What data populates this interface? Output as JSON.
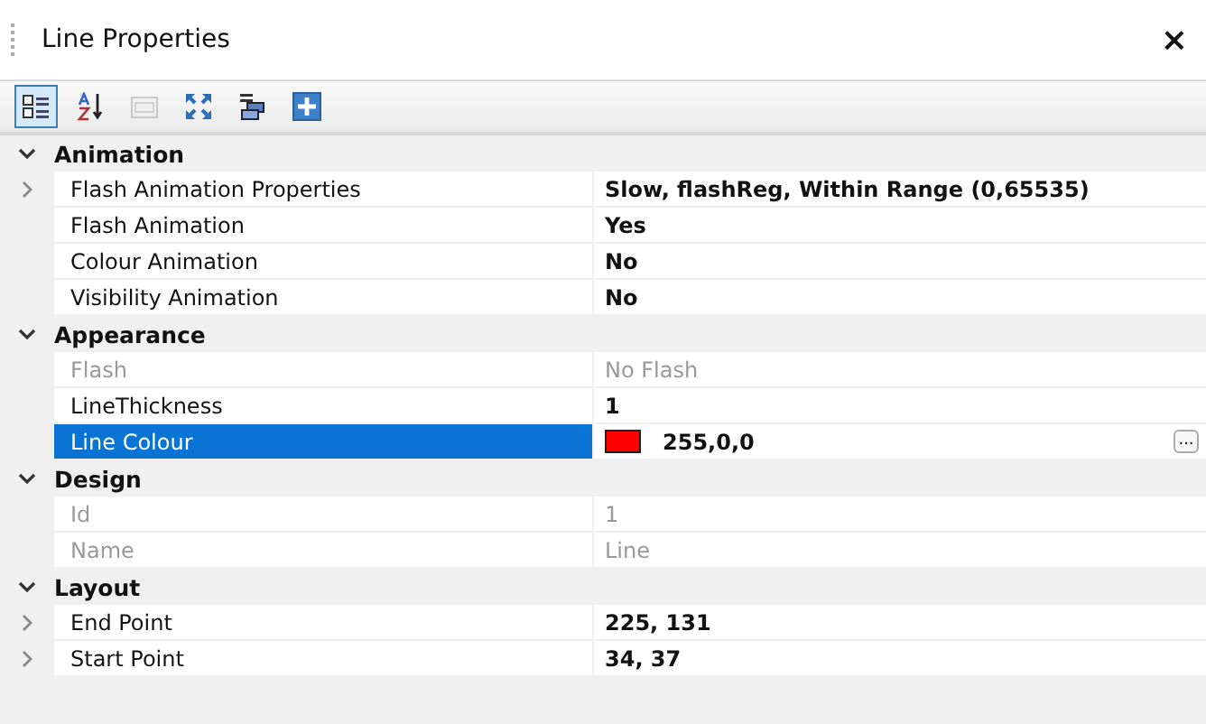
{
  "panel": {
    "title": "Line Properties",
    "close": "×"
  },
  "toolbar": [
    {
      "kind": "categorized",
      "selected": true,
      "disabled": false
    },
    {
      "kind": "alphabetical",
      "selected": false,
      "disabled": false
    },
    {
      "kind": "pages",
      "selected": false,
      "disabled": true
    },
    {
      "kind": "expand",
      "selected": false,
      "disabled": false
    },
    {
      "kind": "windows",
      "selected": false,
      "disabled": false
    },
    {
      "kind": "add",
      "selected": false,
      "disabled": false
    }
  ],
  "categories": [
    {
      "name": "Animation",
      "expanded": true,
      "properties": [
        {
          "name": "Flash Animation Properties",
          "value": "Slow, flashReg, Within Range (0,65535)",
          "expandable": true,
          "readonly": false,
          "selected": false
        },
        {
          "name": "Flash Animation",
          "value": "Yes",
          "expandable": false,
          "readonly": false,
          "selected": false
        },
        {
          "name": "Colour Animation",
          "value": "No",
          "expandable": false,
          "readonly": false,
          "selected": false
        },
        {
          "name": "Visibility Animation",
          "value": "No",
          "expandable": false,
          "readonly": false,
          "selected": false
        }
      ]
    },
    {
      "name": "Appearance",
      "expanded": true,
      "properties": [
        {
          "name": "Flash",
          "value": "No Flash",
          "expandable": false,
          "readonly": true,
          "selected": false
        },
        {
          "name": "LineThickness",
          "value": "1",
          "expandable": false,
          "readonly": false,
          "selected": false
        },
        {
          "name": "Line Colour",
          "value": "255,0,0",
          "expandable": false,
          "readonly": false,
          "selected": true,
          "color": "#ff0000",
          "ellipsis": "..."
        }
      ]
    },
    {
      "name": "Design",
      "expanded": true,
      "properties": [
        {
          "name": "Id",
          "value": "1",
          "expandable": false,
          "readonly": true,
          "selected": false
        },
        {
          "name": "Name",
          "value": "Line",
          "expandable": false,
          "readonly": true,
          "selected": false
        }
      ]
    },
    {
      "name": "Layout",
      "expanded": true,
      "properties": [
        {
          "name": "End Point",
          "value": "225, 131",
          "expandable": true,
          "readonly": false,
          "selected": false
        },
        {
          "name": "Start Point",
          "value": "34, 37",
          "expandable": true,
          "readonly": false,
          "selected": false
        }
      ]
    }
  ]
}
